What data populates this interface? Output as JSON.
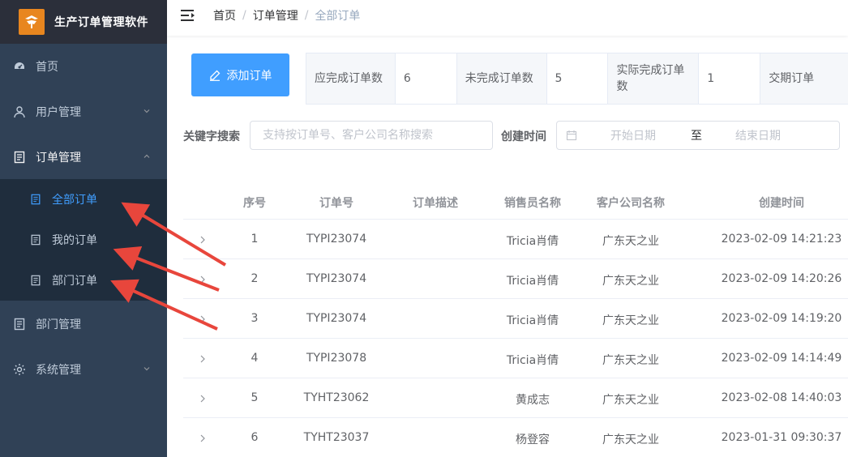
{
  "app": {
    "title": "生产订单管理软件"
  },
  "sidebar": {
    "items": [
      {
        "label": "首页",
        "icon": "dashboard-icon"
      },
      {
        "label": "用户管理",
        "icon": "user-icon"
      },
      {
        "label": "订单管理",
        "icon": "document-icon"
      },
      {
        "label": "部门管理",
        "icon": "document-icon"
      },
      {
        "label": "系统管理",
        "icon": "gear-icon"
      }
    ],
    "submenu": [
      {
        "label": "全部订单",
        "icon": "document-icon",
        "active": true
      },
      {
        "label": "我的订单",
        "icon": "document-icon"
      },
      {
        "label": "部门订单",
        "icon": "document-icon"
      }
    ]
  },
  "breadcrumb": [
    "首页",
    "订单管理",
    "全部订单"
  ],
  "toolbar": {
    "add_label": "添加订单"
  },
  "stats": [
    {
      "label": "应完成订单数",
      "value": "6"
    },
    {
      "label": "未完成订单数",
      "value": "5"
    },
    {
      "label": "实际完成订单数",
      "value": "1"
    },
    {
      "label": "交期订单",
      "value": ""
    }
  ],
  "search": {
    "keyword_label": "关键字搜索",
    "keyword_placeholder": "支持按订单号、客户公司名称搜索",
    "time_label": "创建时间",
    "start_placeholder": "开始日期",
    "range_separator": "至",
    "end_placeholder": "结束日期"
  },
  "table": {
    "columns": [
      "序号",
      "订单号",
      "订单描述",
      "销售员名称",
      "客户公司名称",
      "创建时间"
    ],
    "rows": [
      {
        "index": "1",
        "order_no": "TYPI23074",
        "desc": "",
        "sales": "Tricia肖倩",
        "customer": "广东天之业",
        "created": "2023-02-09 14:21:23"
      },
      {
        "index": "2",
        "order_no": "TYPI23074",
        "desc": "",
        "sales": "Tricia肖倩",
        "customer": "广东天之业",
        "created": "2023-02-09 14:20:26"
      },
      {
        "index": "3",
        "order_no": "TYPI23074",
        "desc": "",
        "sales": "Tricia肖倩",
        "customer": "广东天之业",
        "created": "2023-02-09 14:19:20"
      },
      {
        "index": "4",
        "order_no": "TYPI23078",
        "desc": "",
        "sales": "Tricia肖倩",
        "customer": "广东天之业",
        "created": "2023-02-09 14:14:49"
      },
      {
        "index": "5",
        "order_no": "TYHT23062",
        "desc": "",
        "sales": "黄成志",
        "customer": "广东天之业",
        "created": "2023-02-08 14:40:03"
      },
      {
        "index": "6",
        "order_no": "TYHT23037",
        "desc": "",
        "sales": "杨登容",
        "customer": "广东天之业",
        "created": "2023-01-31 09:30:37"
      }
    ]
  },
  "colors": {
    "sidebar_bg": "#304156",
    "submenu_bg": "#1f2d3d",
    "accent": "#409eff",
    "annotation_arrow": "#e8463c"
  }
}
